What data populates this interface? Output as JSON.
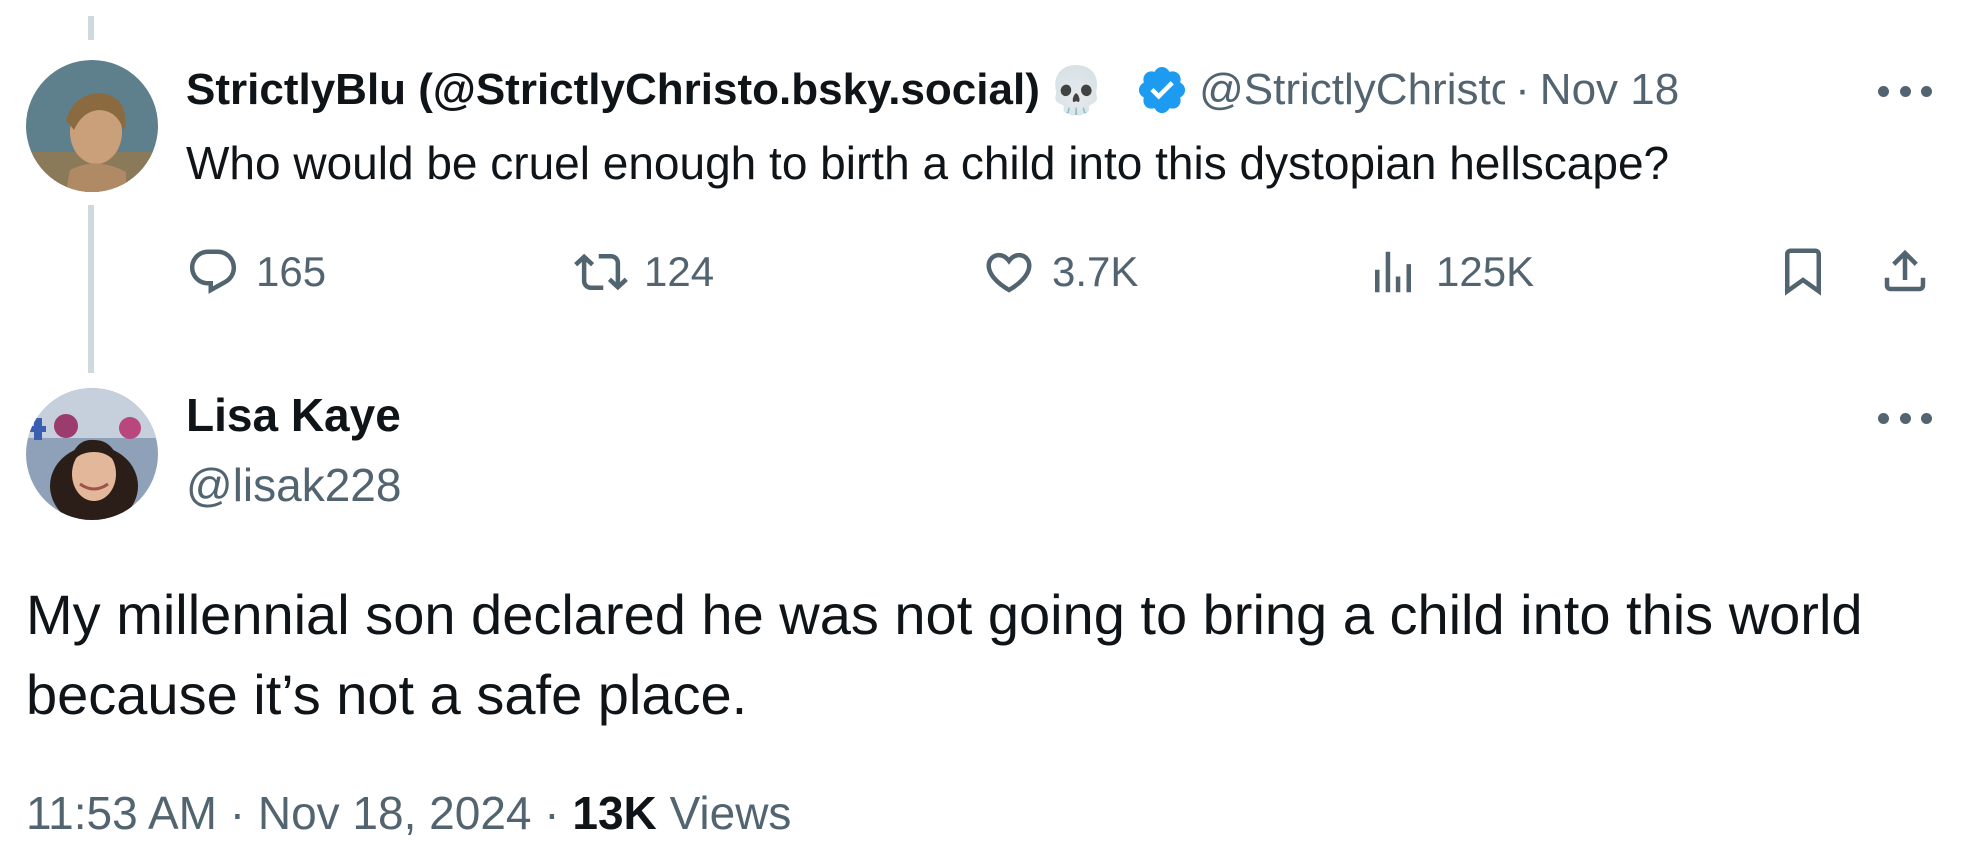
{
  "parent_tweet": {
    "display_name": "StrictlyBlu (@StrictlyChristo.bsky.social)",
    "emoji": "💀",
    "handle": "@StrictlyChristo",
    "date": "Nov 18",
    "text": "Who would be cruel enough to birth a child into this dystopian hellscape?",
    "verified": true,
    "stats": {
      "replies": "165",
      "reposts": "124",
      "likes": "3.7K",
      "views": "125K"
    }
  },
  "main_tweet": {
    "display_name": "Lisa Kaye",
    "handle": "@lisak228",
    "text": "My millennial son declared he was not going to bring a child into this world because it’s not a safe place.",
    "time": "11:53 AM",
    "date": "Nov 18, 2024",
    "views_count": "13K",
    "views_label": "Views"
  },
  "separator": "·",
  "colors": {
    "text": "#0f1419",
    "secondary": "#536471",
    "verified_blue": "#1d9bf0",
    "thread_line": "#cfd9de"
  },
  "icons": [
    "reply-icon",
    "repost-icon",
    "like-icon",
    "views-icon",
    "bookmark-icon",
    "share-icon",
    "more-icon",
    "verified-badge-icon"
  ]
}
